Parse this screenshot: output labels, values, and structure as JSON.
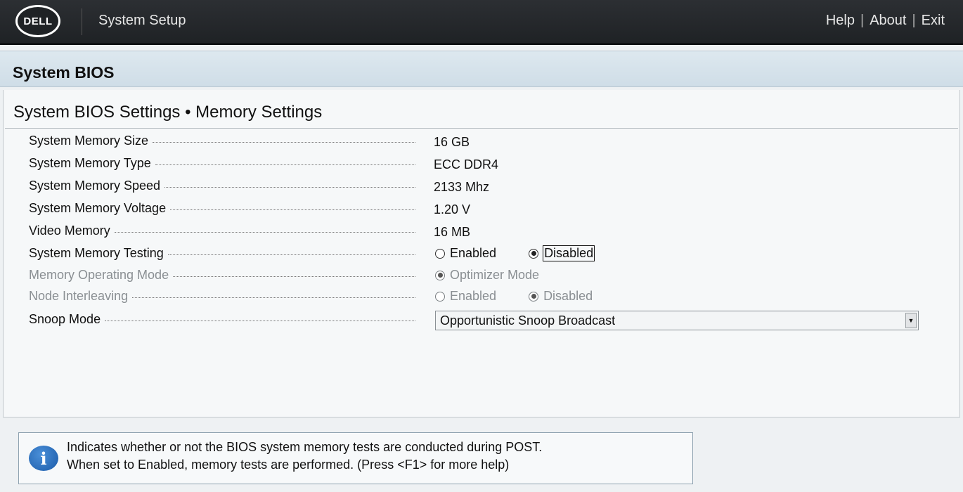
{
  "header": {
    "logo_text": "DELL",
    "app_title": "System Setup",
    "links": [
      "Help",
      "About",
      "Exit"
    ],
    "separator": "|"
  },
  "section": {
    "title": "System BIOS"
  },
  "page": {
    "title": "System BIOS Settings • Memory Settings"
  },
  "settings": {
    "memory_size": {
      "label": "System Memory Size",
      "value": "16 GB"
    },
    "memory_type": {
      "label": "System Memory Type",
      "value": "ECC DDR4"
    },
    "memory_speed": {
      "label": "System Memory Speed",
      "value": "2133 Mhz"
    },
    "memory_voltage": {
      "label": "System Memory Voltage",
      "value": "1.20 V"
    },
    "video_memory": {
      "label": "Video Memory",
      "value": "16 MB"
    },
    "memory_testing": {
      "label": "System Memory Testing",
      "options": [
        "Enabled",
        "Disabled"
      ],
      "selected": "Disabled"
    },
    "operating_mode": {
      "label": "Memory Operating Mode",
      "options": [
        "Optimizer Mode"
      ],
      "selected": "Optimizer Mode"
    },
    "node_interleaving": {
      "label": "Node Interleaving",
      "options": [
        "Enabled",
        "Disabled"
      ],
      "selected": "Disabled"
    },
    "snoop_mode": {
      "label": "Snoop Mode",
      "value": "Opportunistic Snoop Broadcast"
    }
  },
  "help": {
    "icon": "info-icon",
    "line1": "Indicates whether or not the BIOS system memory tests are conducted during POST.",
    "line2": "When set to Enabled, memory tests are performed. (Press <F1> for more help)"
  }
}
